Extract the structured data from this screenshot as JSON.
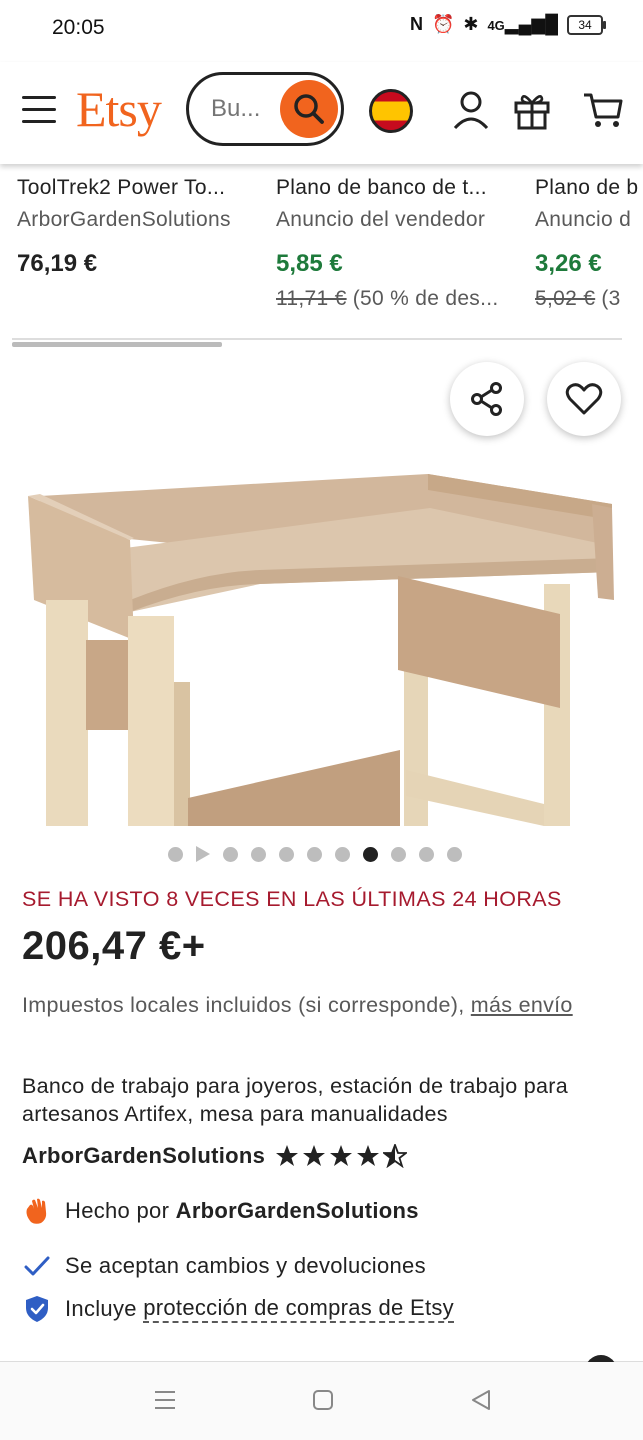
{
  "status_bar": {
    "time": "20:05",
    "network": "4G",
    "battery": "34"
  },
  "header": {
    "logo_text": "Etsy",
    "search_placeholder": "Bu...",
    "brand_color": "#F1641E",
    "icons": [
      "menu-icon",
      "search-icon",
      "spain-flag-icon",
      "account-icon",
      "gift-icon",
      "cart-icon"
    ]
  },
  "recommendations": [
    {
      "title": "ToolTrek2 Power To...",
      "subtitle": "ArborGardenSolutions",
      "price": "76,19 €",
      "original_price": "",
      "discount": ""
    },
    {
      "title": "Plano de banco de t...",
      "subtitle": "Anuncio del vendedor",
      "price": "5,85 €",
      "original_price": "11,71 €",
      "discount": "(50 % de des..."
    },
    {
      "title": "Plano de b",
      "subtitle": "Anuncio d",
      "price": "3,26 €",
      "original_price": "5,02 €",
      "discount": "(3"
    }
  ],
  "listing": {
    "image_count": 11,
    "active_image_index": 7,
    "views_notice": "SE HA VISTO 8 VECES EN LAS ÚLTIMAS 24 HORAS",
    "price": "206,47 €+",
    "taxes_text": "Impuestos locales incluidos (si corresponde),",
    "taxes_link": "más envío",
    "title": "Banco de trabajo para joyeros, estación de trabajo para artesanos Artifex, mesa para manualidades",
    "shop_name": "ArborGardenSolutions",
    "rating": 4.5,
    "made_by_prefix": "Hecho por",
    "made_by_shop": "ArborGardenSolutions",
    "returns_text": "Se aceptan cambios y devoluciones",
    "protection_prefix": "Incluye",
    "protection_link": "protección de compras de Etsy"
  },
  "colors": {
    "sale_green": "#1E7A3B",
    "views_red": "#A61A2E",
    "check_blue": "#2F5EC4"
  }
}
